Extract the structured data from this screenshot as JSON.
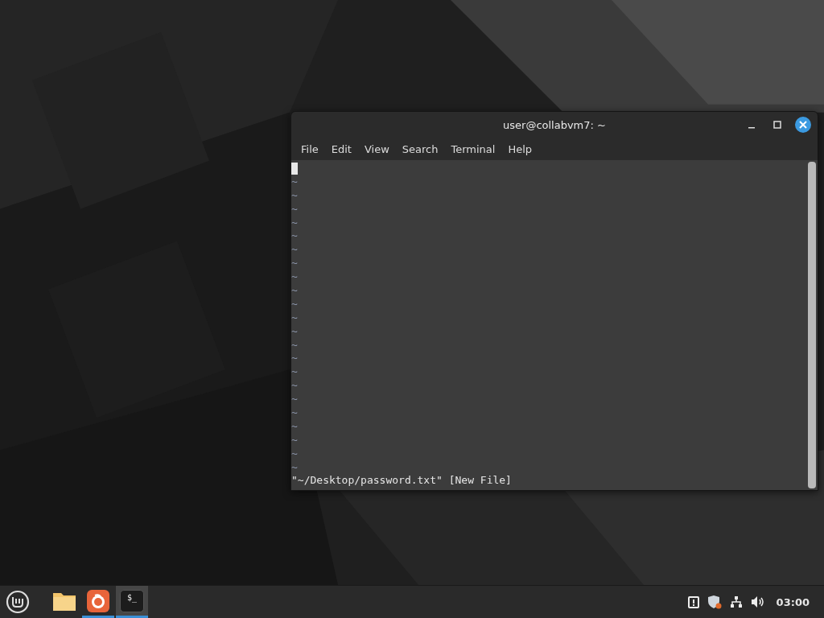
{
  "window": {
    "title": "user@collabvm7: ~",
    "focused": true
  },
  "menu": [
    "File",
    "Edit",
    "View",
    "Search",
    "Terminal",
    "Help"
  ],
  "editor": {
    "tildes": [
      "~",
      "~",
      "~",
      "~",
      "~",
      "~",
      "~",
      "~",
      "~",
      "~",
      "~",
      "~",
      "~",
      "~",
      "~",
      "~",
      "~",
      "~",
      "~",
      "~",
      "~",
      "~"
    ],
    "status": "\"~/Desktop/password.txt\" [New File]"
  },
  "taskbar": {
    "apps": [
      {
        "kind": "files",
        "running": false,
        "focused": false
      },
      {
        "kind": "browser",
        "running": true,
        "focused": false
      },
      {
        "kind": "terminal",
        "running": true,
        "focused": true,
        "glyph": "$_"
      }
    ],
    "clock": "03:00"
  }
}
